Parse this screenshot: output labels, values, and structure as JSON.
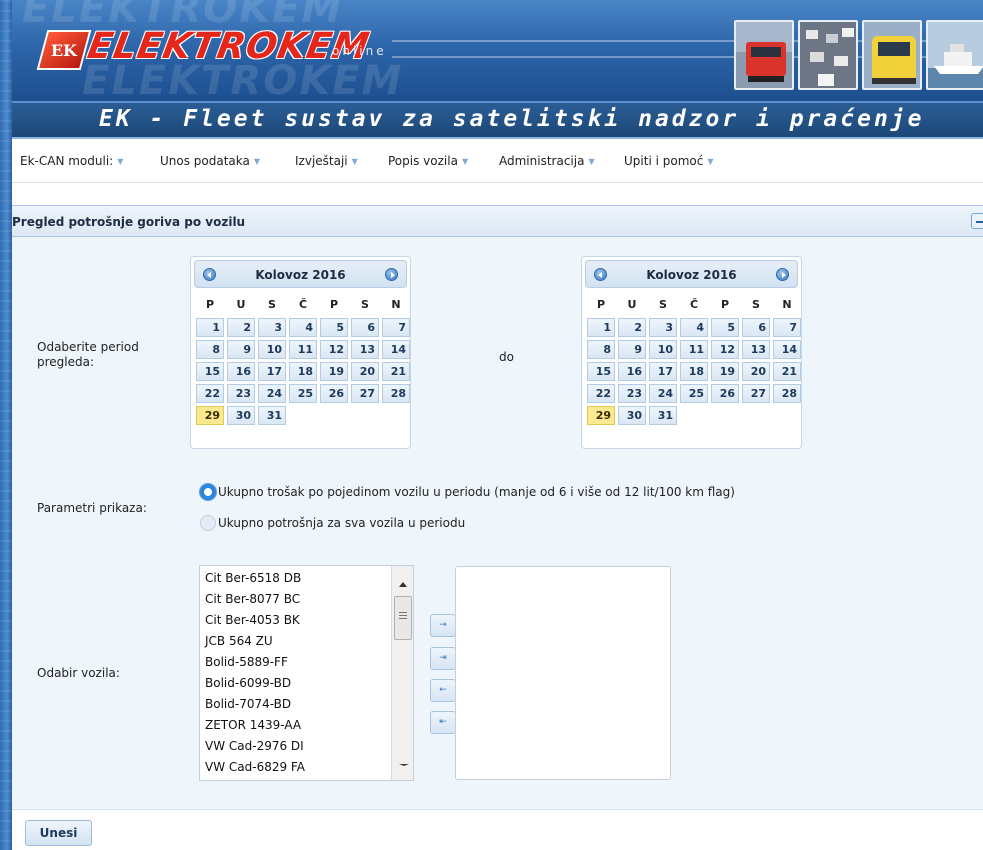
{
  "header": {
    "logo_mark": "EK",
    "logo_text": "ELEKTROKEM",
    "logo_suffix": "online",
    "app_title": "EK - Fleet sustav za satelitski nadzor i praćenje"
  },
  "menu": [
    {
      "label": "Ek-CAN moduli:"
    },
    {
      "label": "Unos podataka"
    },
    {
      "label": "Izvještaji"
    },
    {
      "label": "Popis vozila"
    },
    {
      "label": "Administracija"
    },
    {
      "label": "Upiti i pomoć"
    }
  ],
  "panel": {
    "title": "Pregled potrošnje goriva po vozilu"
  },
  "period": {
    "label": "Odaberite period pregleda:",
    "separator": "do",
    "from_calendar": {
      "month_label": "Kolovoz 2016",
      "weekdays": [
        "P",
        "U",
        "S",
        "Č",
        "P",
        "S",
        "N"
      ],
      "days": [
        "1",
        "2",
        "3",
        "4",
        "5",
        "6",
        "7",
        "8",
        "9",
        "10",
        "11",
        "12",
        "13",
        "14",
        "15",
        "16",
        "17",
        "18",
        "19",
        "20",
        "21",
        "22",
        "23",
        "24",
        "25",
        "26",
        "27",
        "28",
        "29",
        "30",
        "31"
      ],
      "selected_day": "29"
    },
    "to_calendar": {
      "month_label": "Kolovoz 2016",
      "weekdays": [
        "P",
        "U",
        "S",
        "Č",
        "P",
        "S",
        "N"
      ],
      "days": [
        "1",
        "2",
        "3",
        "4",
        "5",
        "6",
        "7",
        "8",
        "9",
        "10",
        "11",
        "12",
        "13",
        "14",
        "15",
        "16",
        "17",
        "18",
        "19",
        "20",
        "21",
        "22",
        "23",
        "24",
        "25",
        "26",
        "27",
        "28",
        "29",
        "30",
        "31"
      ],
      "selected_day": "29"
    }
  },
  "display_params": {
    "label": "Parametri prikaza:",
    "options": [
      {
        "label": "Ukupno trošak po pojedinom vozilu u periodu (manje od 6 i više od 12 lit/100 km flag)",
        "checked": true
      },
      {
        "label": "Ukupno potrošnja za sva vozila u periodu",
        "checked": false
      }
    ]
  },
  "vehicles": {
    "label": "Odabir vozila:",
    "available": [
      "Cit Ber-6518 DB",
      "Cit Ber-8077 BC",
      "Cit Ber-4053 BK",
      "JCB 564 ZU",
      "Bolid-5889-FF",
      "Bolid-6099-BD",
      "Bolid-7074-BD",
      "ZETOR 1439-AA",
      "VW Cad-2976 DI",
      "VW Cad-6829 FA"
    ],
    "selected": [],
    "buttons": {
      "add_one": "→",
      "add_all": "⇥",
      "remove_one": "←",
      "remove_all": "⇤"
    }
  },
  "submit_label": "Unesi",
  "colors": {
    "title_bar": "#1c4878",
    "panel_bg": "#eef5fb",
    "today_highlight": "#fbe98f",
    "accent": "#2f86d8"
  }
}
